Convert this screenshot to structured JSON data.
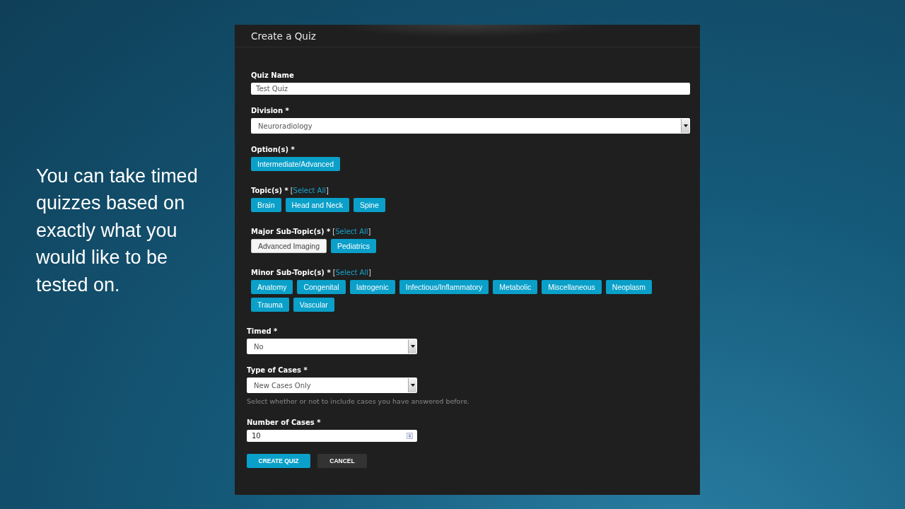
{
  "slide_text": "You can take timed quizzes based on exactly what you would like to be tested on.",
  "dialog": {
    "title": "Create a Quiz",
    "fields": [
      {
        "kind": "text",
        "label": "Quiz Name",
        "value": "Test Quiz"
      },
      {
        "kind": "select",
        "label": "Division *",
        "value": "Neuroradiology"
      },
      {
        "kind": "chips",
        "label": "Option(s) *",
        "chips": [
          {
            "label": "Intermediate/Advanced",
            "selected": true
          }
        ]
      },
      {
        "kind": "chips",
        "label": "Topic(s) *",
        "link": "[Select All]",
        "chips": [
          {
            "label": "Brain",
            "selected": true
          },
          {
            "label": "Head and Neck",
            "selected": true
          },
          {
            "label": "Spine",
            "selected": true
          }
        ]
      },
      {
        "kind": "chips",
        "label": "Major Sub-Topic(s) *",
        "link": "[Select All]",
        "chips": [
          {
            "label": "Advanced Imaging",
            "selected": false
          },
          {
            "label": "Pediatrics",
            "selected": true
          }
        ]
      },
      {
        "kind": "chips",
        "label": "Minor Sub-Topic(s) *",
        "link": "[Select All]",
        "chips": [
          {
            "label": "Anatomy",
            "selected": true
          },
          {
            "label": "Congenital",
            "selected": true
          },
          {
            "label": "Iatrogenic",
            "selected": true
          },
          {
            "label": "Infectious/Inflammatory",
            "selected": true
          },
          {
            "label": "Metabolic",
            "selected": true
          },
          {
            "label": "Miscellaneous",
            "selected": true
          },
          {
            "label": "Neoplasm",
            "selected": true
          },
          {
            "label": "Trauma",
            "selected": true
          },
          {
            "label": "Vascular",
            "selected": true
          }
        ]
      }
    ],
    "settings": [
      {
        "kind": "select",
        "label": "Timed *",
        "value": "No"
      },
      {
        "kind": "select",
        "label": "Type of Cases *",
        "value": "New Cases Only",
        "hint": "Select whether or not to include cases you have answered before."
      },
      {
        "kind": "number",
        "label": "Number of Cases *",
        "value": "10"
      }
    ],
    "buttons": [
      {
        "kind": "primary",
        "label": "CREATE QUIZ"
      },
      {
        "kind": "secondary",
        "label": "CANCEL"
      }
    ]
  }
}
